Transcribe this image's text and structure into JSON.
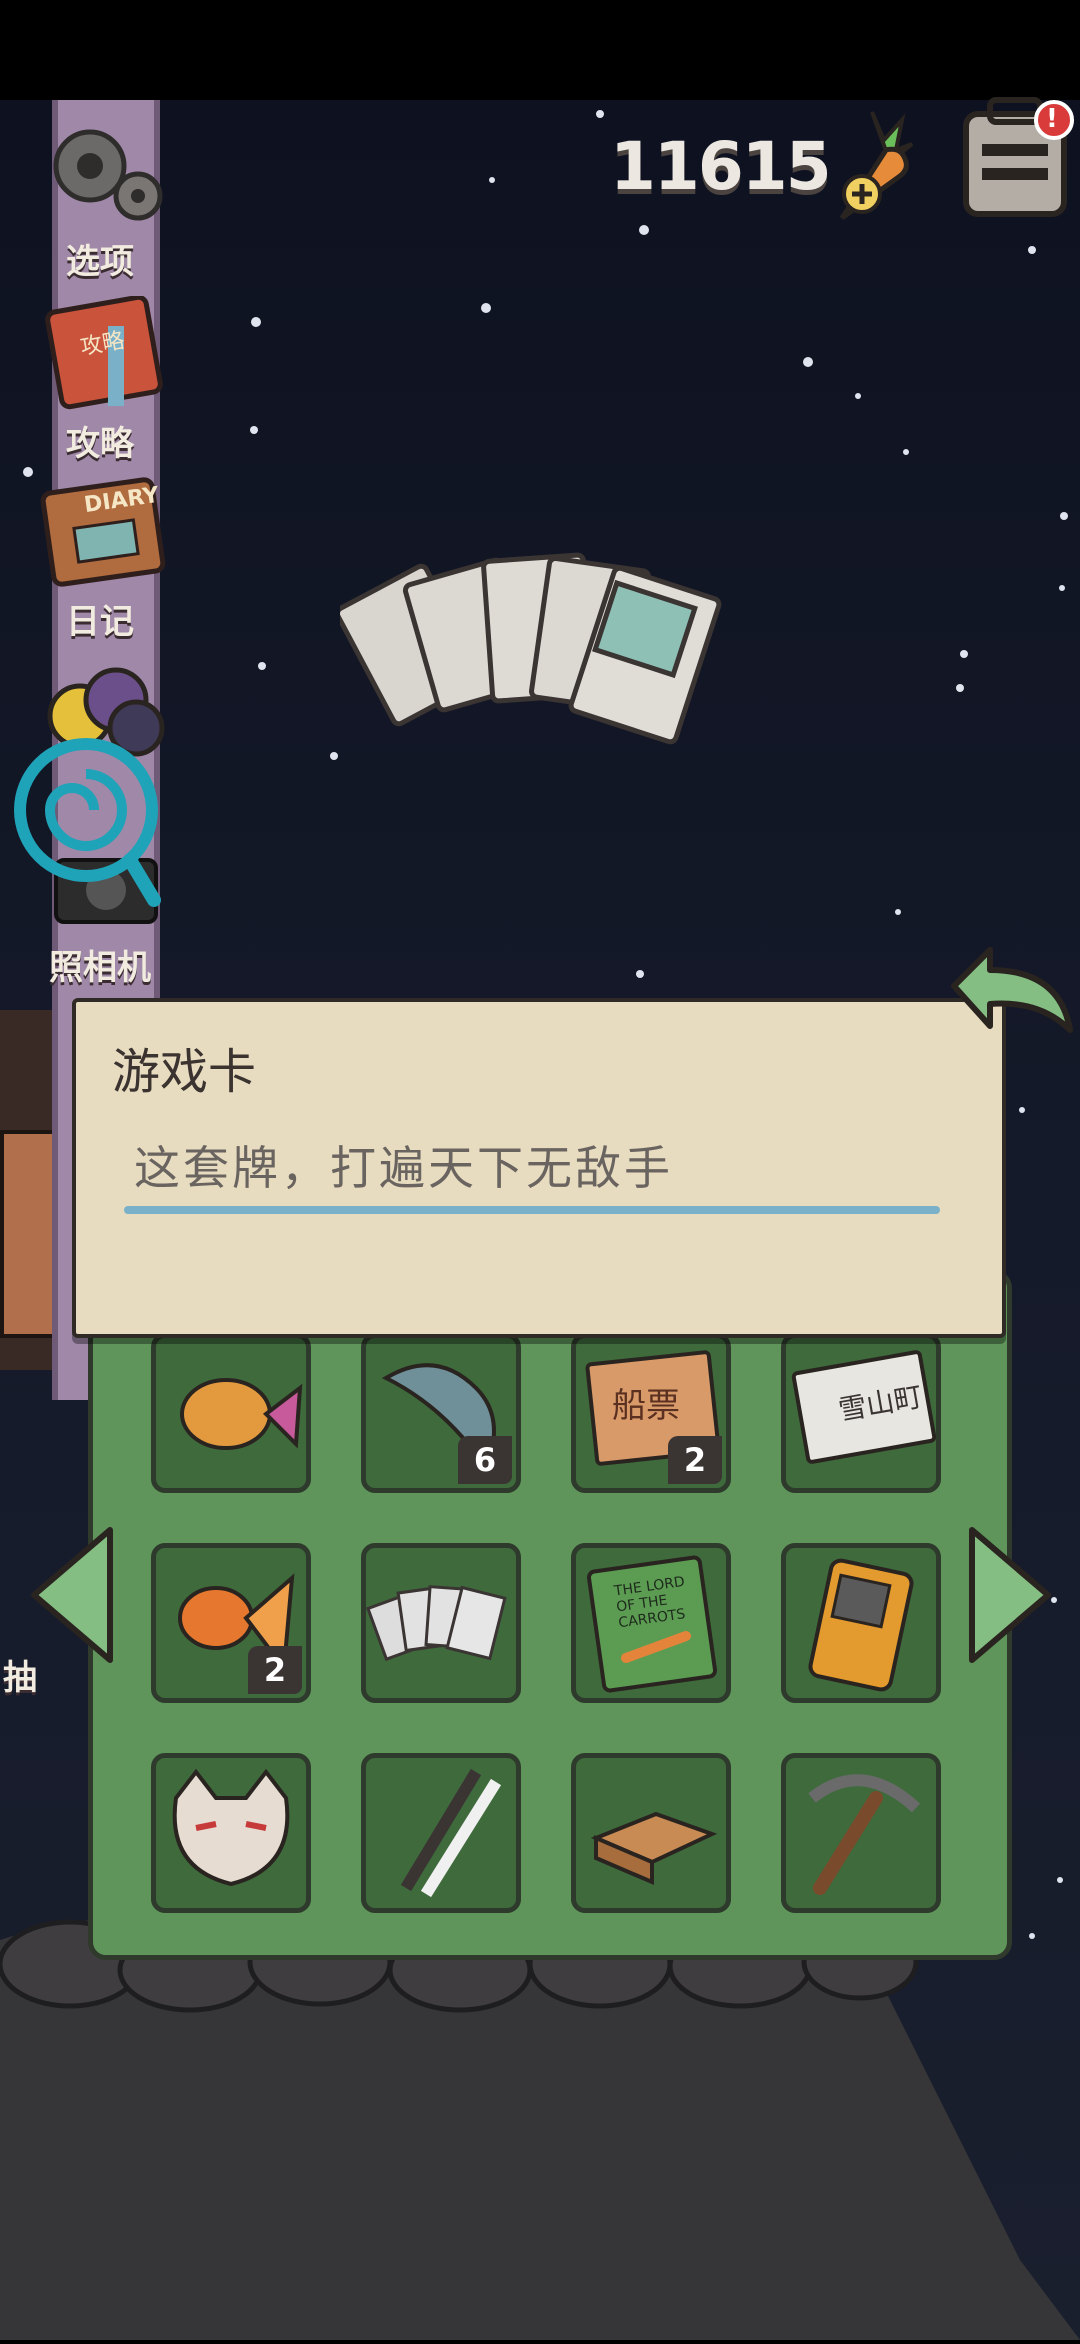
{
  "hud": {
    "carrot_count": "11615",
    "icons": [
      "carrot-plus-icon",
      "backpack-icon"
    ],
    "notification_mark": "!"
  },
  "sidebar": {
    "items": [
      {
        "label": "选项",
        "icon": "gear-icon"
      },
      {
        "label": "攻略",
        "icon": "guide-book-icon"
      },
      {
        "label": "日记",
        "icon": "diary-icon"
      },
      {
        "label": "照相机",
        "icon": "camera-icon"
      },
      {
        "label": "抽",
        "icon": "drawer-icon"
      }
    ],
    "guide_book_text": "攻略",
    "diary_text": "DIARY"
  },
  "featured_item": {
    "icon": "game-cards-icon"
  },
  "dialog": {
    "title": "游戏卡",
    "description": "这套牌，打遍天下无敌手"
  },
  "inventory": {
    "rows": [
      [
        {
          "icon": "fish-lantern-icon",
          "count": ""
        },
        {
          "icon": "dried-fish-icon",
          "count": "6"
        },
        {
          "icon": "boat-ticket-icon",
          "count": "2",
          "text": "船票"
        },
        {
          "icon": "snow-ticket-icon",
          "count": "",
          "text": "雪山町"
        }
      ],
      [
        {
          "icon": "goldfish-icon",
          "count": "2"
        },
        {
          "icon": "game-cards-icon",
          "count": ""
        },
        {
          "icon": "carrot-book-icon",
          "count": "",
          "text": "THE LORD OF THE CARROTS"
        },
        {
          "icon": "handheld-console-icon",
          "count": ""
        }
      ],
      [
        {
          "icon": "cat-mask-icon",
          "count": ""
        },
        {
          "icon": "ski-poles-icon",
          "count": ""
        },
        {
          "icon": "matchbox-icon",
          "count": ""
        },
        {
          "icon": "pickaxe-icon",
          "count": ""
        }
      ]
    ]
  },
  "nav": {
    "prev_icon": "left-arrow-icon",
    "next_icon": "right-arrow-icon",
    "back_icon": "back-arrow-icon"
  },
  "colors": {
    "panel_green": "#5f955a",
    "dialog_bg": "#e8dcc0",
    "accent_blue": "#7ab1c8",
    "sidebar_purple": "#a088a8"
  }
}
